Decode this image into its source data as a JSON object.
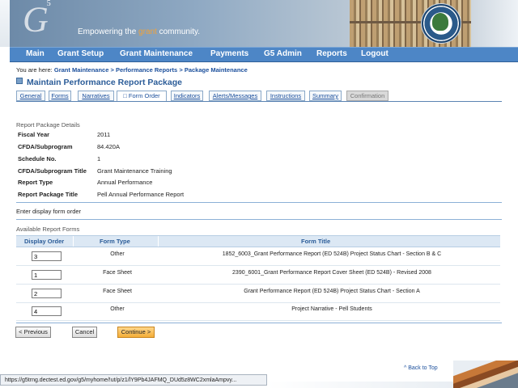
{
  "header": {
    "logo_text": "G",
    "logo_sup": "5",
    "tagline_pre": "Empowering the ",
    "tagline_accent": "grant",
    "tagline_post": " community."
  },
  "nav": [
    "Main",
    "Grant Setup",
    "Grant Maintenance",
    "Payments",
    "G5 Admin",
    "Reports",
    "Logout"
  ],
  "breadcrumb": {
    "prefix": "You are here:",
    "items": [
      "Grant Maintenance",
      "Performance Reports",
      "Package Maintenance"
    ],
    "sep": ">"
  },
  "page_title": "Maintain Performance Report Package",
  "tabs": [
    "General",
    "Forms",
    "Narratives",
    "Form Order",
    "Indicators",
    "Alerts/Messages",
    "Instructions",
    "Summary",
    "Confirmation"
  ],
  "active_tab": "Form Order",
  "details": {
    "section_label": "Report Package Details",
    "rows": [
      {
        "label": "Fiscal Year",
        "value": "2011"
      },
      {
        "label": "CFDA/Subprogram",
        "value": "84.420A"
      },
      {
        "label": "Schedule No.",
        "value": "1"
      },
      {
        "label": "CFDA/Subprogram Title",
        "value": "Grant Maintenance Training"
      },
      {
        "label": "Report Type",
        "value": "Annual Performance"
      },
      {
        "label": "Report Package Title",
        "value": "Pell Annual Performance Report"
      }
    ]
  },
  "instructions": "Enter display form order",
  "forms_table": {
    "section_label": "Available Report Forms",
    "headers": [
      "Display Order",
      "Form Type",
      "Form Title"
    ],
    "rows": [
      {
        "order": "3",
        "type": "Other",
        "title": "1852_6003_Grant Performance Report (ED 524B) Project Status Chart - Section B & C"
      },
      {
        "order": "1",
        "type": "Face Sheet",
        "title": "2390_6001_Grant Performance Report Cover Sheet (ED 524B) - Revised 2008"
      },
      {
        "order": "2",
        "type": "Face Sheet",
        "title": "Grant Performance Report (ED 524B) Project Status Chart - Section A"
      },
      {
        "order": "4",
        "type": "Other",
        "title": "Project Narrative - Pell Students"
      }
    ]
  },
  "buttons": {
    "previous": "< Previous",
    "cancel": "Cancel",
    "continue": "Continue >"
  },
  "back_to_top": "^ Back to Top",
  "status_url": "https://g5trng.dectest.ed.gov/g5/myhome/!ut/p/z1/lY9Pb4JAFMQ_DUd5z8WC2xmlaAmpvy..."
}
